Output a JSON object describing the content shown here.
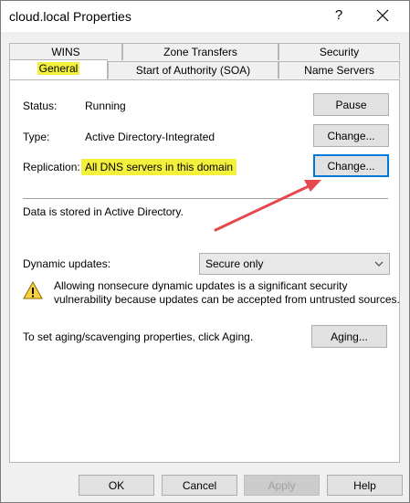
{
  "window": {
    "title": "cloud.local Properties",
    "help_glyph": "?",
    "close_icon": "close-icon"
  },
  "tabs": {
    "row_back": [
      "WINS",
      "Zone Transfers",
      "Security"
    ],
    "row_front": [
      "General",
      "Start of Authority (SOA)",
      "Name Servers"
    ],
    "active": "General"
  },
  "general": {
    "status_label": "Status:",
    "status_value": "Running",
    "pause_button": "Pause",
    "type_label": "Type:",
    "type_value": "Active Directory-Integrated",
    "type_change_button": "Change...",
    "replication_label": "Replication:",
    "replication_value": "All DNS servers in this domain",
    "replication_change_button": "Change...",
    "storage_text": "Data is stored in Active Directory.",
    "dynamic_updates_label": "Dynamic updates:",
    "dynamic_updates_value": "Secure only",
    "warning_line1": "Allowing nonsecure dynamic updates is a significant security",
    "warning_line2": "vulnerability because updates can be accepted from untrusted sources.",
    "aging_text": "To set aging/scavenging properties, click Aging.",
    "aging_button": "Aging..."
  },
  "footer": {
    "ok": "OK",
    "cancel": "Cancel",
    "apply": "Apply",
    "help": "Help"
  },
  "colors": {
    "highlight": "#f4f13c",
    "annotation_arrow": "#e5484d",
    "focus": "#0078d7"
  }
}
